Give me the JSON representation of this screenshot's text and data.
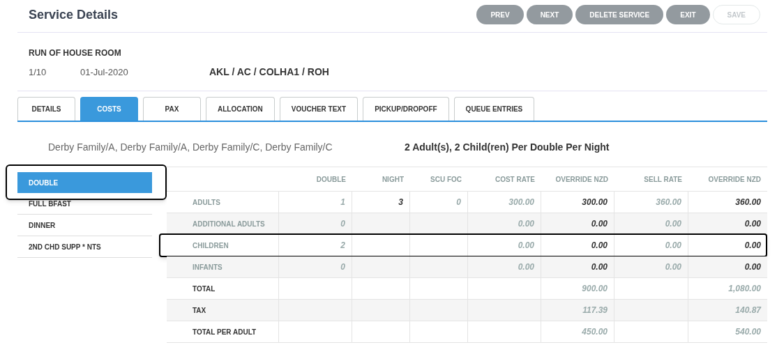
{
  "header": {
    "title": "Service Details",
    "buttons": [
      {
        "label": "PREV",
        "disabled": false
      },
      {
        "label": "NEXT",
        "disabled": false
      },
      {
        "label": "DELETE SERVICE",
        "disabled": false
      },
      {
        "label": "EXIT",
        "disabled": false
      },
      {
        "label": "SAVE",
        "disabled": true
      }
    ]
  },
  "service": {
    "name": "RUN OF HOUSE ROOM",
    "sequence": "1/10",
    "date": "01-Jul-2020",
    "code": "AKL / AC / COLHA1 / ROH"
  },
  "tabs": [
    {
      "label": "DETAILS",
      "selected": false
    },
    {
      "label": "COSTS",
      "selected": true
    },
    {
      "label": "PAX",
      "selected": false
    },
    {
      "label": "ALLOCATION",
      "selected": false
    },
    {
      "label": "VOUCHER TEXT",
      "selected": false
    },
    {
      "label": "PICKUP/DROPOFF",
      "selected": false
    },
    {
      "label": "QUEUE ENTRIES",
      "selected": false
    }
  ],
  "pax_names": "Derby Family/A, Derby Family/A, Derby Family/C, Derby Family/C",
  "pax_summary": "2 Adult(s), 2 Child(ren) Per Double Per Night",
  "sidebar": {
    "items": [
      {
        "label": "DOUBLE",
        "selected": true,
        "outlined": true
      },
      {
        "label": "FULL BFAST",
        "selected": false,
        "outlined": false
      },
      {
        "label": "DINNER",
        "selected": false,
        "outlined": false
      },
      {
        "label": "2ND CHD SUPP * NTS",
        "selected": false,
        "outlined": false
      }
    ]
  },
  "table": {
    "columns": [
      {
        "label": "DOUBLE",
        "kind": "computed"
      },
      {
        "label": "NIGHT",
        "kind": "override"
      },
      {
        "label": "SCU FOC",
        "kind": "computed"
      },
      {
        "label": "COST RATE",
        "kind": "computed"
      },
      {
        "label": "OVERRIDE NZD",
        "kind": "override"
      },
      {
        "label": "SELL RATE",
        "kind": "computed"
      },
      {
        "label": "OVERRIDE NZD",
        "kind": "override"
      }
    ],
    "rows": [
      {
        "label": "ADULTS",
        "kind": "entry",
        "outlined": false,
        "cells": [
          "1",
          "3",
          "0",
          "300.00",
          "300.00",
          "360.00",
          "360.00"
        ]
      },
      {
        "label": "ADDITIONAL ADULTS",
        "kind": "entry",
        "outlined": false,
        "cells": [
          "0",
          "",
          "",
          "0.00",
          "0.00",
          "0.00",
          "0.00"
        ]
      },
      {
        "label": "CHILDREN",
        "kind": "entry",
        "outlined": true,
        "cells": [
          "2",
          "",
          "",
          "0.00",
          "0.00",
          "0.00",
          "0.00"
        ]
      },
      {
        "label": "INFANTS",
        "kind": "entry",
        "outlined": false,
        "cells": [
          "0",
          "",
          "",
          "0.00",
          "0.00",
          "0.00",
          "0.00"
        ]
      },
      {
        "label": "TOTAL",
        "kind": "total",
        "outlined": false,
        "cells": [
          "",
          "",
          "",
          "",
          "900.00",
          "",
          "1,080.00"
        ]
      },
      {
        "label": "TAX",
        "kind": "total",
        "outlined": false,
        "cells": [
          "",
          "",
          "",
          "",
          "117.39",
          "",
          "140.87"
        ]
      },
      {
        "label": "TOTAL PER ADULT",
        "kind": "total",
        "outlined": false,
        "cells": [
          "",
          "",
          "",
          "",
          "450.00",
          "",
          "540.00"
        ]
      }
    ]
  }
}
